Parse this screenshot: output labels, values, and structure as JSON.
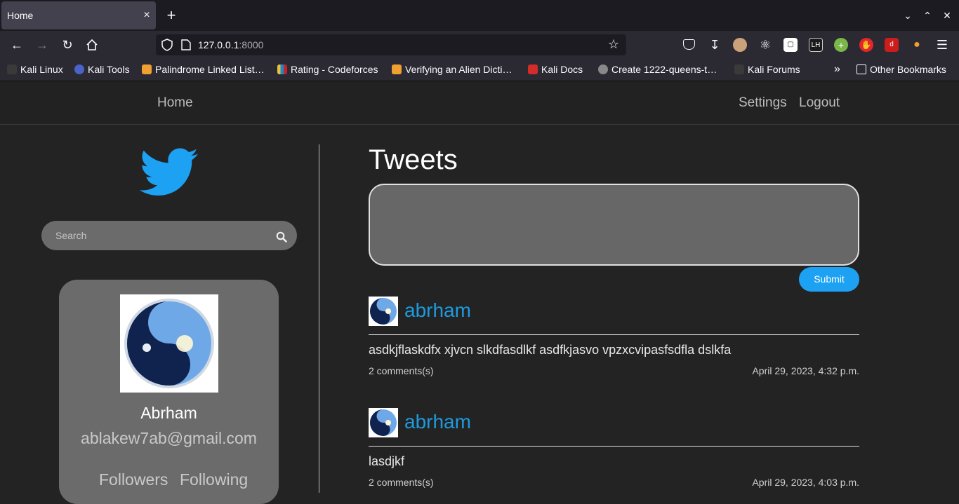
{
  "browser": {
    "tab_title": "Home",
    "tab_close": "×",
    "new_tab": "+",
    "url_host": "127.0.0.1",
    "url_port": ":8000",
    "bookmarks": [
      {
        "label": "Kali Linux",
        "color": "#3a3a3a"
      },
      {
        "label": "Kali Tools",
        "color": "#4b63c6"
      },
      {
        "label": "Palindrome Linked List…",
        "color": "#f0a030"
      },
      {
        "label": "Rating - Codeforces",
        "color": "#e8c33a"
      },
      {
        "label": "Verifying an Alien Dicti…",
        "color": "#f0a030"
      },
      {
        "label": "Kali Docs",
        "color": "#d42b2b"
      },
      {
        "label": "Create 1222-queens-t…",
        "color": "#888888"
      },
      {
        "label": "Kali Forums",
        "color": "#3a3a3a"
      }
    ],
    "other_bookmarks": "Other Bookmarks"
  },
  "site_nav": {
    "home": "Home",
    "settings": "Settings",
    "logout": "Logout"
  },
  "sidebar": {
    "search_placeholder": "Search",
    "profile": {
      "name": "Abrham",
      "email": "ablakew7ab@gmail.com",
      "followers_label": "Followers",
      "following_label": "Following"
    }
  },
  "main": {
    "title": "Tweets",
    "submit_label": "Submit",
    "tweets": [
      {
        "author": "abrham",
        "text": "asdkjflaskdfx xjvcn slkdfasdlkf asdfkjasvo vpzxcvipasfsdfla dslkfa",
        "comments": "2 comments(s)",
        "date": "April 29, 2023, 4:32 p.m."
      },
      {
        "author": "abrham",
        "text": "lasdjkf",
        "comments": "2 comments(s)",
        "date": "April 29, 2023, 4:03 p.m."
      }
    ]
  },
  "colors": {
    "accent": "#1da1f2",
    "author_link": "#1d9bdf",
    "card": "#6b6b6b",
    "page_bg": "#232323"
  }
}
